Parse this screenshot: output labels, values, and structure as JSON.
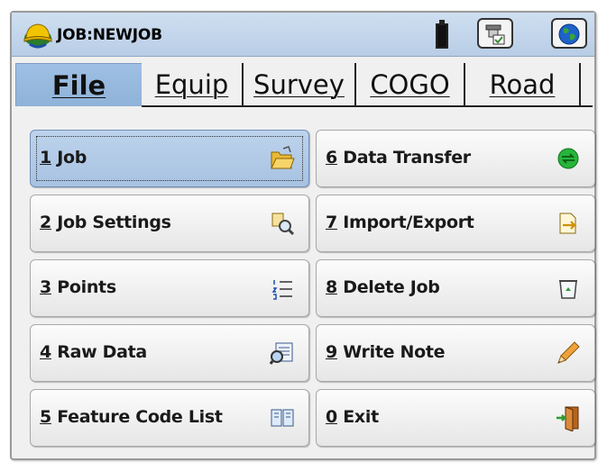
{
  "title_bar": {
    "job_label": "JOB:NEWJOB",
    "logo_icon": "hardhat-logo-icon",
    "battery_icon": "battery-icon",
    "buttons": [
      {
        "icon": "instrument-icon"
      },
      {
        "icon": "globe-icon"
      }
    ]
  },
  "tabs": [
    {
      "label": "File",
      "active": true
    },
    {
      "label": "Equip",
      "active": false
    },
    {
      "label": "Survey",
      "active": false
    },
    {
      "label": "COGO",
      "active": false
    },
    {
      "label": "Road",
      "active": false
    }
  ],
  "menu": [
    {
      "num": "1",
      "text": " Job",
      "icon": "open-folder-icon",
      "selected": true
    },
    {
      "num": "2",
      "text": " Job Settings",
      "icon": "settings-magnifier-icon"
    },
    {
      "num": "3",
      "text": " Points",
      "icon": "numbered-list-icon"
    },
    {
      "num": "4",
      "text": " Raw Data",
      "icon": "data-inspect-icon"
    },
    {
      "num": "5",
      "text": " Feature Code List",
      "icon": "book-icon"
    },
    {
      "num": "6",
      "text": " Data Transfer",
      "icon": "transfer-globe-icon"
    },
    {
      "num": "7",
      "text": " Import/Export",
      "icon": "file-export-icon"
    },
    {
      "num": "8",
      "text": " Delete Job",
      "icon": "recycle-bin-icon"
    },
    {
      "num": "9",
      "text": " Write Note",
      "icon": "pencil-icon"
    },
    {
      "num": "0",
      "text": " Exit",
      "icon": "exit-door-icon"
    }
  ],
  "colors": {
    "title_bar": "#b8cde6",
    "active_tab": "#8fb2d8",
    "selected_button": "#a7c2e2",
    "button_face": "#e6e6e6"
  }
}
